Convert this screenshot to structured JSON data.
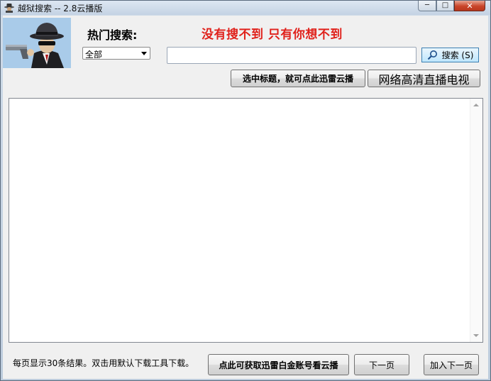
{
  "window": {
    "title": "越狱搜索 -- 2.8云播版",
    "minimize_symbol": "─",
    "maximize_symbol": "□",
    "close_symbol": "✕"
  },
  "header": {
    "hot_search_label": "热门搜索:",
    "slogan": "没有搜不到 只有你想不到"
  },
  "category_select": {
    "selected": "全部"
  },
  "search": {
    "value": "",
    "button_label": "搜索 (S)"
  },
  "actions": {
    "select_title_button": "选中标题，就可点此迅雷云播",
    "live_tv_button": "网络高清直播电视"
  },
  "results": {
    "items": []
  },
  "footer": {
    "status": "每页显示30条结果。双击用默认下载工具下载。",
    "account_button": "点此可获取迅雷白金账号看云播",
    "next_page_button": "下一页",
    "add_next_page_button": "加入下一页"
  },
  "icons": {
    "app": "hat-man-icon",
    "logo": "gangster-with-gun-icon",
    "search": "magnifier-icon"
  },
  "colors": {
    "slogan": "#e0211b",
    "search_button_border": "#3c7fb1",
    "logo_background": "#a9cbe9"
  }
}
